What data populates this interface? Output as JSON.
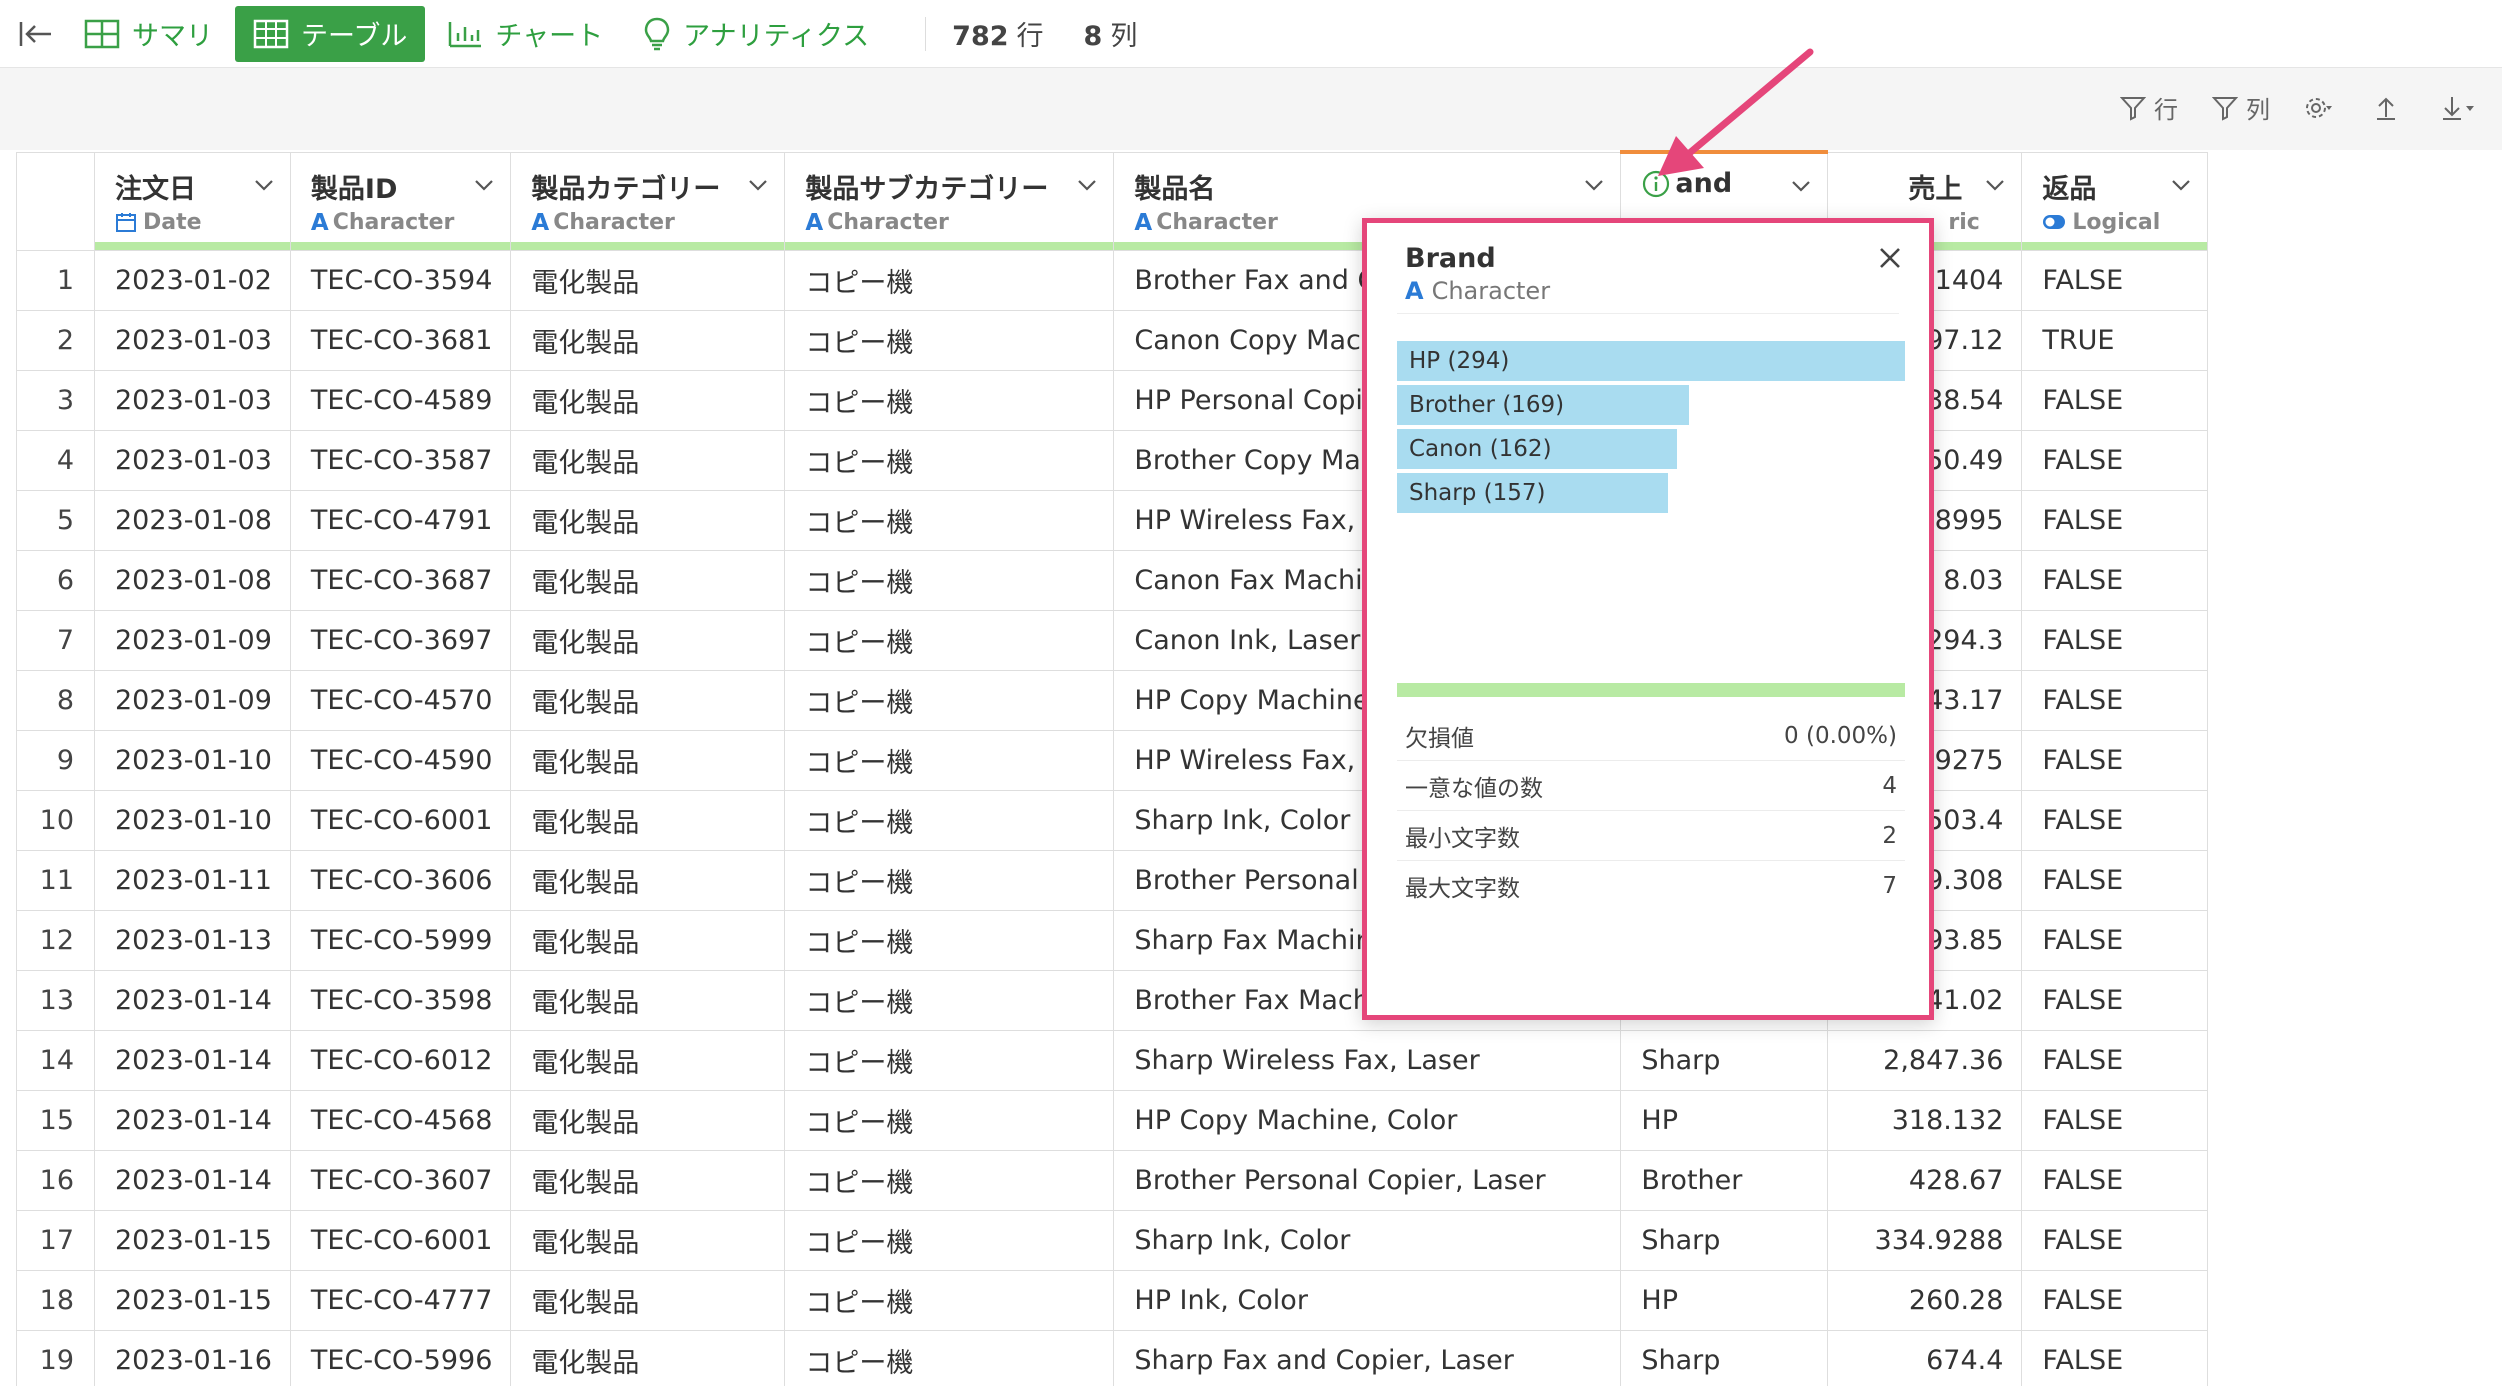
{
  "toolbar": {
    "tabs": [
      {
        "label": "サマリ",
        "active": false
      },
      {
        "label": "テーブル",
        "active": true
      },
      {
        "label": "チャート",
        "active": false
      },
      {
        "label": "アナリティクス",
        "active": false
      }
    ],
    "rows_count": "782",
    "rows_unit": "行",
    "cols_count": "8",
    "cols_unit": "列"
  },
  "subtools": {
    "filter_rows": "行",
    "filter_cols": "列"
  },
  "columns": [
    {
      "name": "注文日",
      "type": "Date",
      "type_icon": "calendar-icon"
    },
    {
      "name": "製品ID",
      "type": "Character",
      "type_icon": "A"
    },
    {
      "name": "製品カテゴリー",
      "type": "Character",
      "type_icon": "A"
    },
    {
      "name": "製品サブカテゴリー",
      "type": "Character",
      "type_icon": "A"
    },
    {
      "name": "製品名",
      "type": "Character",
      "type_icon": "A"
    },
    {
      "name": "and",
      "type": "",
      "type_icon": "A"
    },
    {
      "name": "売上",
      "type": "ric",
      "type_icon": "#"
    },
    {
      "name": "返品",
      "type": "Logical",
      "type_icon": "toggle-icon"
    }
  ],
  "rows": [
    {
      "n": "1",
      "date": "2023-01-02",
      "id": "TEC-CO-3594",
      "cat": "電化製品",
      "sub": "コピー機",
      "name": "Brother Fax and Co",
      "brand": "",
      "sales": "1404",
      "ret": "FALSE"
    },
    {
      "n": "2",
      "date": "2023-01-03",
      "id": "TEC-CO-3681",
      "cat": "電化製品",
      "sub": "コピー機",
      "name": "Canon Copy Mach",
      "brand": "",
      "sales": "97.12",
      "ret": "TRUE"
    },
    {
      "n": "3",
      "date": "2023-01-03",
      "id": "TEC-CO-4589",
      "cat": "電化製品",
      "sub": "コピー機",
      "name": "HP Personal Copie",
      "brand": "",
      "sales": "38.54",
      "ret": "FALSE"
    },
    {
      "n": "4",
      "date": "2023-01-03",
      "id": "TEC-CO-3587",
      "cat": "電化製品",
      "sub": "コピー機",
      "name": "Brother Copy Mach",
      "brand": "",
      "sales": "50.49",
      "ret": "FALSE"
    },
    {
      "n": "5",
      "date": "2023-01-08",
      "id": "TEC-CO-4791",
      "cat": "電化製品",
      "sub": "コピー機",
      "name": "HP Wireless Fax, H",
      "brand": "",
      "sales": "8995",
      "ret": "FALSE"
    },
    {
      "n": "6",
      "date": "2023-01-08",
      "id": "TEC-CO-3687",
      "cat": "電化製品",
      "sub": "コピー機",
      "name": "Canon Fax Machin",
      "brand": "",
      "sales": "8.03",
      "ret": "FALSE"
    },
    {
      "n": "7",
      "date": "2023-01-09",
      "id": "TEC-CO-3697",
      "cat": "電化製品",
      "sub": "コピー機",
      "name": "Canon Ink, Laser",
      "brand": "",
      "sales": "294.3",
      "ret": "FALSE"
    },
    {
      "n": "8",
      "date": "2023-01-09",
      "id": "TEC-CO-4570",
      "cat": "電化製品",
      "sub": "コピー機",
      "name": "HP Copy Machine,",
      "brand": "",
      "sales": "43.17",
      "ret": "FALSE"
    },
    {
      "n": "9",
      "date": "2023-01-10",
      "id": "TEC-CO-4590",
      "cat": "電化製品",
      "sub": "コピー機",
      "name": "HP Wireless Fax, C",
      "brand": "",
      "sales": "9275",
      "ret": "FALSE"
    },
    {
      "n": "10",
      "date": "2023-01-10",
      "id": "TEC-CO-6001",
      "cat": "電化製品",
      "sub": "コピー機",
      "name": "Sharp Ink, Color",
      "brand": "",
      "sales": "503.4",
      "ret": "FALSE"
    },
    {
      "n": "11",
      "date": "2023-01-11",
      "id": "TEC-CO-3606",
      "cat": "電化製品",
      "sub": "コピー機",
      "name": "Brother Personal C",
      "brand": "",
      "sales": "9.308",
      "ret": "FALSE"
    },
    {
      "n": "12",
      "date": "2023-01-13",
      "id": "TEC-CO-5999",
      "cat": "電化製品",
      "sub": "コピー機",
      "name": "Sharp Fax Machine",
      "brand": "",
      "sales": "93.85",
      "ret": "FALSE"
    },
    {
      "n": "13",
      "date": "2023-01-14",
      "id": "TEC-CO-3598",
      "cat": "電化製品",
      "sub": "コピー機",
      "name": "Brother Fax Machin",
      "brand": "",
      "sales": "41.02",
      "ret": "FALSE"
    },
    {
      "n": "14",
      "date": "2023-01-14",
      "id": "TEC-CO-6012",
      "cat": "電化製品",
      "sub": "コピー機",
      "name": "Sharp Wireless Fax, Laser",
      "brand": "Sharp",
      "sales": "2,847.36",
      "ret": "FALSE"
    },
    {
      "n": "15",
      "date": "2023-01-14",
      "id": "TEC-CO-4568",
      "cat": "電化製品",
      "sub": "コピー機",
      "name": "HP Copy Machine, Color",
      "brand": "HP",
      "sales": "318.132",
      "ret": "FALSE"
    },
    {
      "n": "16",
      "date": "2023-01-14",
      "id": "TEC-CO-3607",
      "cat": "電化製品",
      "sub": "コピー機",
      "name": "Brother Personal Copier, Laser",
      "brand": "Brother",
      "sales": "428.67",
      "ret": "FALSE"
    },
    {
      "n": "17",
      "date": "2023-01-15",
      "id": "TEC-CO-6001",
      "cat": "電化製品",
      "sub": "コピー機",
      "name": "Sharp Ink, Color",
      "brand": "Sharp",
      "sales": "334.9288",
      "ret": "FALSE"
    },
    {
      "n": "18",
      "date": "2023-01-15",
      "id": "TEC-CO-4777",
      "cat": "電化製品",
      "sub": "コピー機",
      "name": "HP Ink, Color",
      "brand": "HP",
      "sales": "260.28",
      "ret": "FALSE"
    },
    {
      "n": "19",
      "date": "2023-01-16",
      "id": "TEC-CO-5996",
      "cat": "電化製品",
      "sub": "コピー機",
      "name": "Sharp Fax and Copier, Laser",
      "brand": "Sharp",
      "sales": "674.4",
      "ret": "FALSE"
    }
  ],
  "popover": {
    "title": "Brand",
    "type": "Character",
    "bars": [
      {
        "label": "HP (294)",
        "value": 294
      },
      {
        "label": "Brother (169)",
        "value": 169
      },
      {
        "label": "Canon (162)",
        "value": 162
      },
      {
        "label": "Sharp (157)",
        "value": 157
      }
    ],
    "stats": [
      {
        "label": "欠損値",
        "value": "0 (0.00%)"
      },
      {
        "label": "一意な値の数",
        "value": "4"
      },
      {
        "label": "最小文字数",
        "value": "2"
      },
      {
        "label": "最大文字数",
        "value": "7"
      }
    ]
  },
  "colors": {
    "accent_green": "#3aa047",
    "highlight_pink": "#e5467a",
    "bar_blue": "#a9dcf0",
    "quality_green": "#b8eaa3",
    "selected_col": "#f08d3c"
  }
}
